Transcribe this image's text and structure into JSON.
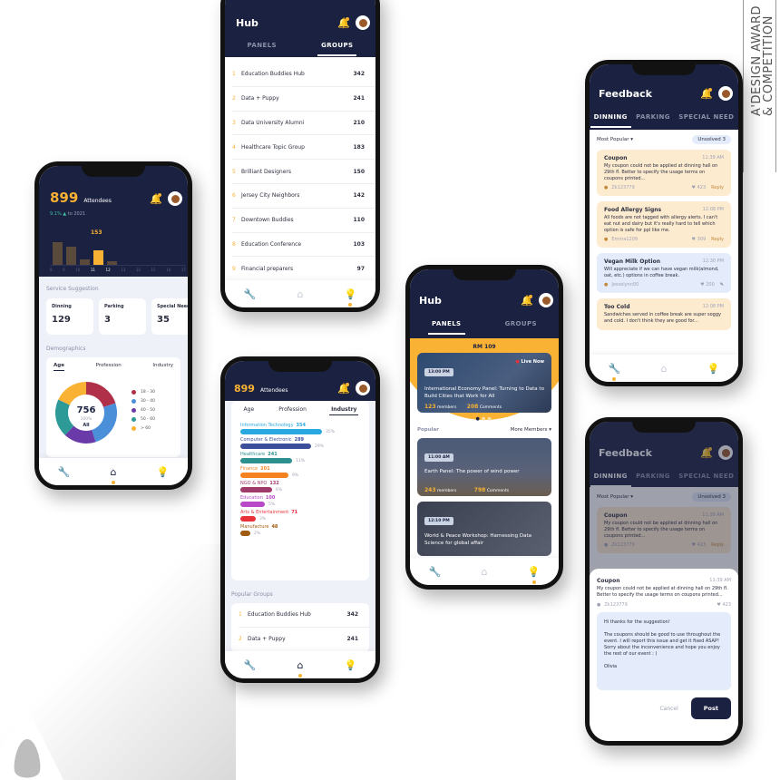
{
  "award": {
    "line1": "A'DESIGN AWARD",
    "line2": "& COMPETITION"
  },
  "phone1": {
    "attendees_count": "899",
    "attendees_label": "Attendees",
    "growth": "9.1%",
    "growth_suffix": "to 2021",
    "highlight_value": "153",
    "hours": [
      "8",
      "9",
      "10",
      "11",
      "12",
      "13",
      "14",
      "15",
      "16",
      "17"
    ],
    "hour_values": [
      0.85,
      0.68,
      0.2,
      0.55,
      0.12,
      0,
      0,
      0,
      0,
      0
    ],
    "highlight_index": 3,
    "service_title": "Service Suggestion",
    "services": [
      {
        "label": "Dinning",
        "value": "129"
      },
      {
        "label": "Parking",
        "value": "3"
      },
      {
        "label": "Special Needs",
        "value": "35"
      }
    ],
    "demographics_title": "Demographics",
    "demo_tabs": [
      "Age",
      "Profession",
      "Industry"
    ],
    "donut_total": "756",
    "donut_pct": "100%",
    "donut_label": "All",
    "nav": [
      "wrench-icon",
      "home-icon",
      "bulb-icon"
    ]
  },
  "chart_data": {
    "type": "pie",
    "title": "Demographics - Age",
    "categories": [
      "18 - 30",
      "30 - 40",
      "40 - 50",
      "50 - 60",
      "> 60"
    ],
    "values": [
      20,
      25,
      17,
      20,
      18
    ],
    "colors": [
      "#b0304a",
      "#4a8fd8",
      "#6a3aa8",
      "#2e9a98",
      "#f9b233"
    ],
    "total": 756
  },
  "phone2": {
    "title": "Hub",
    "tabs": [
      "PANELS",
      "GROUPS"
    ],
    "groups": [
      {
        "rank": "1",
        "name": "Education Buddies Hub",
        "count": "342"
      },
      {
        "rank": "2",
        "name": "Data + Puppy",
        "count": "241"
      },
      {
        "rank": "3",
        "name": "Data University Alumni",
        "count": "210"
      },
      {
        "rank": "4",
        "name": "Healthcare Topic Group",
        "count": "183"
      },
      {
        "rank": "5",
        "name": "Brilliant Designers",
        "count": "150"
      },
      {
        "rank": "6",
        "name": "Jersey City Neighbors",
        "count": "142"
      },
      {
        "rank": "7",
        "name": "Downtown Buddies",
        "count": "110"
      },
      {
        "rank": "8",
        "name": "Education Conference",
        "count": "103"
      },
      {
        "rank": "9",
        "name": "Financial preparers",
        "count": "97"
      }
    ]
  },
  "phone3": {
    "attendees_count": "899",
    "attendees_label": "Attendees",
    "demo_tabs": [
      "Age",
      "Profession",
      "Industry"
    ],
    "industries": [
      {
        "name": "Information Technology",
        "value": "354",
        "pct": "35%",
        "frac": 0.9,
        "color": "#29a8e0"
      },
      {
        "name": "Computer & Electronic",
        "value": "289",
        "pct": "29%",
        "frac": 0.78,
        "color": "#3b4f9a"
      },
      {
        "name": "Healthcare",
        "value": "241",
        "pct": "11%",
        "frac": 0.57,
        "color": "#2e8f8f"
      },
      {
        "name": "Finance",
        "value": "201",
        "pct": "9%",
        "frac": 0.53,
        "color": "#f58220"
      },
      {
        "name": "NGO & NPO",
        "value": "132",
        "pct": "6%",
        "frac": 0.35,
        "color": "#a03a6a"
      },
      {
        "name": "Education",
        "value": "100",
        "pct": "5%",
        "frac": 0.27,
        "color": "#b84ac8"
      },
      {
        "name": "Arts & Entertainment",
        "value": "71",
        "pct": "3%",
        "frac": 0.17,
        "color": "#e8323a"
      },
      {
        "name": "Manufacture",
        "value": "48",
        "pct": "2%",
        "frac": 0.11,
        "color": "#a05a10"
      }
    ],
    "popular_title": "Popular Groups",
    "groups": [
      {
        "rank": "1",
        "name": "Education Buddies Hub",
        "count": "342"
      },
      {
        "rank": "2",
        "name": "Data + Puppy",
        "count": "241"
      }
    ]
  },
  "phone4": {
    "title": "Hub",
    "tabs": [
      "PANELS",
      "GROUPS"
    ],
    "featured_label": "RM 109",
    "featured": {
      "time": "13:00 PM",
      "live": "Live Now",
      "title": "International Economy Panel: Turning to Data to Build Cities that Work for All",
      "members": "123",
      "members_label": "members",
      "comments": "208",
      "comments_label": "Comments"
    },
    "popular_label": "Popular",
    "sort_label": "More Members",
    "panels": [
      {
        "time": "11:00 AM",
        "title": "Earth Panel: The power of wind power",
        "members": "243",
        "members_label": "members",
        "comments": "798",
        "comments_label": "Comments"
      },
      {
        "time": "12:10 PM",
        "title": "World & Peace Workshop: Harnessing Data Science for global affair"
      }
    ]
  },
  "phone5": {
    "title": "Feedback",
    "tabs": [
      "DINNING",
      "PARKING",
      "SPECIAL NEED"
    ],
    "sort_label": "Most Popular",
    "unsolved_label": "Unsolved",
    "unsolved_count": "3",
    "reply_label": "Reply",
    "items": [
      {
        "title": "Coupon",
        "time": "11:39 AM",
        "body": "My coupon could not be applied at dinning hall on 29th fl. Better to specify the usage terms on coupons printed...",
        "user": "Zk123779",
        "likes": "423",
        "tone": "peach",
        "action": "Reply"
      },
      {
        "title": "Food Allergy Signs",
        "time": "12:08 PM",
        "body": "All foods are not tagged with allergy alerts. I can't eat nut and dairy but it's really hard to tell which option is safe for ppl like me.",
        "user": "Emma1209",
        "likes": "309",
        "tone": "peach",
        "action": "Reply"
      },
      {
        "title": "Vegan Milk Option",
        "time": "12:30 PM",
        "body": "Will appreciate if we can have vegan milk(almond, oat, etc.) options in coffee break.",
        "user": "Jesselynn00",
        "likes": "200",
        "tone": "lblue",
        "action": ""
      },
      {
        "title": "Too Cold",
        "time": "12:08 PM",
        "body": "Sandwiches served in coffee break are super soggy and cold. I don't think they are good for...",
        "user": "",
        "likes": "",
        "tone": "peach",
        "action": ""
      }
    ]
  },
  "phone6": {
    "title": "Feedback",
    "tabs": [
      "DINNING",
      "PARKING",
      "SPECIAL NEED"
    ],
    "sort_label": "Most Popular",
    "unsolved_label": "Unsolved",
    "unsolved_count": "3",
    "bg_item": {
      "title": "Coupon",
      "time": "11:39 AM",
      "body": "My coupon could not be applied at dinning hall on 29th fl. Better to specify the usage terms on coupons printed...",
      "user": "Zk123779",
      "likes": "423",
      "action": "Reply"
    },
    "sheet_item": {
      "title": "Coupon",
      "time": "11:39 AM",
      "body": "My coupon could not be applied at dinning hall on 29th fl. Better to specify the usage terms on coupons printed...",
      "user": "Zk123779",
      "likes": "423"
    },
    "reply_text": [
      "Hi thanks for the suggestion!",
      "The coupons should be good to use throughout the event. I will report this issue and get it fixed ASAP! Sorry about the inconvenience and hope you enjoy the rest of our event : )",
      "Olivia"
    ],
    "cancel_label": "Cancel",
    "post_label": "Post"
  }
}
